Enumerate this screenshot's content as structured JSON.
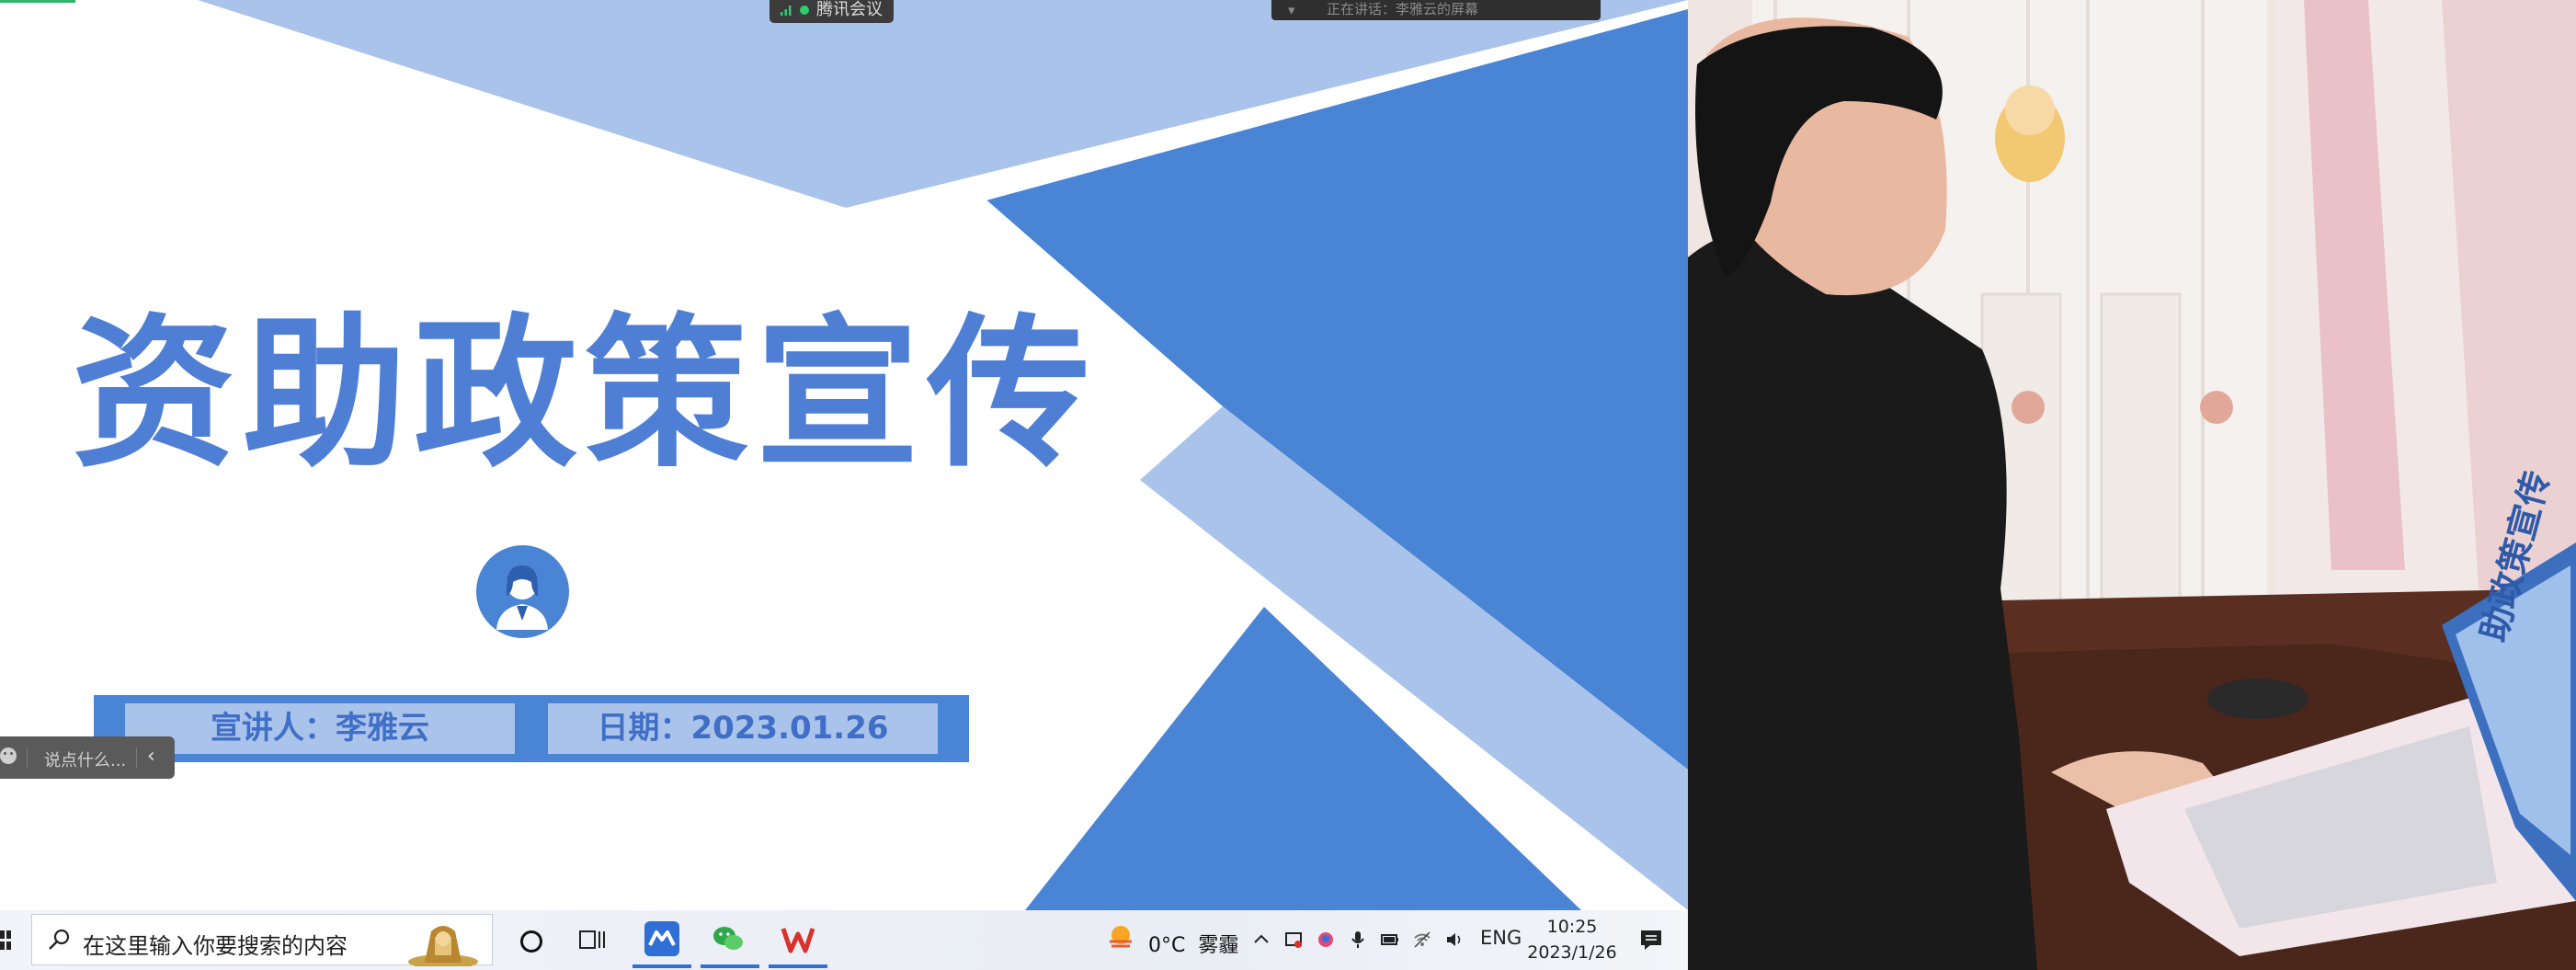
{
  "slide": {
    "title": "资助政策宣传",
    "presenter": "宣讲人：李雅云",
    "date": "日期：2023.01.26",
    "colors": {
      "dark_blue": "#4a84d4",
      "light_blue": "#a9c3ea",
      "title_blue": "#4f7fd4"
    }
  },
  "meeting": {
    "app_label": "腾讯会议",
    "shared_screen_label": "正在讲话：李雅云的屏幕"
  },
  "chat": {
    "placeholder": "说点什么...",
    "collapse_icon": "chevron-left-icon"
  },
  "taskbar": {
    "search_placeholder": "在这里输入你要搜索的内容",
    "apps": [
      {
        "name": "meeting-app-icon",
        "color": "#2f6fd6"
      },
      {
        "name": "wechat-app-icon",
        "color": "#2ea84a"
      },
      {
        "name": "wps-app-icon",
        "color": "#d9312b"
      }
    ],
    "weather": {
      "temp": "0°C",
      "condition": "雾霾"
    },
    "tray_icons": [
      "chevron-up-icon",
      "system-icon",
      "app-tray-icon",
      "microphone-icon",
      "battery-icon",
      "wifi-icon",
      "volume-icon"
    ],
    "language": "ENG",
    "time": "10:25",
    "date": "2023/1/26"
  },
  "camera": {
    "laptop_screen_text": "助政策宣传"
  }
}
